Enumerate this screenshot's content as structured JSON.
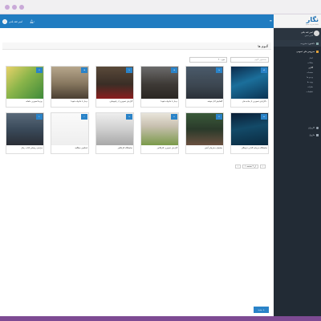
{
  "topbar": {
    "user_name": "امیر ثقه بلتی",
    "bell_count": "1"
  },
  "brand": {
    "logo": "نگار",
    "tagline": "سامانه مدیریت محتوا"
  },
  "sidebar": {
    "user_name": "امیر ثقه بلتی",
    "user_role": "کاربر ادمین",
    "items": [
      {
        "label": "داشبورد مدیریت"
      },
      {
        "label": "سرویس های عمومی"
      },
      {
        "label": "اخبار"
      },
      {
        "label": "مقالات"
      },
      {
        "label": "گالری"
      },
      {
        "label": "صفحات"
      },
      {
        "label": "ویدیو ها"
      },
      {
        "label": "پیوند ها"
      },
      {
        "label": "نظرات"
      },
      {
        "label": "تنظیمات"
      },
      {
        "label": "کاربران"
      },
      {
        "label": "ماژول"
      }
    ]
  },
  "page": {
    "title": "آلبوم ها",
    "search_placeholder": "جستجوی آلبوم",
    "select_value": "۲۰ مورد"
  },
  "albums": [
    {
      "caption": "گزارش تصویری از جاذبه های...",
      "badge": "۲۴"
    },
    {
      "caption": "گشایش آثار خوشه",
      "badge": "۱۲"
    },
    {
      "caption": "دیدار با خانواده شهدا",
      "badge": "۱۸"
    },
    {
      "caption": "گزارش تصویری از راهپیمایی",
      "badge": "۹"
    },
    {
      "caption": "دیدار با خانواده شهدا",
      "badge": "۱۵"
    },
    {
      "caption": "روزها تصویری ماهانه",
      "badge": "۷"
    },
    {
      "caption": "نمایشگاه سرمایه گذاری فرهنگی",
      "badge": "۲۲"
    },
    {
      "caption": "جشنواره هنرهای آئینی",
      "badge": "۱۱"
    },
    {
      "caption": "گزارش تصویری کاریکاتور",
      "badge": "۸"
    },
    {
      "caption": "نمایشگاه کاریکاتور",
      "badge": "۱۳"
    },
    {
      "caption": "اسکیس مطالعه",
      "badge": "۶"
    },
    {
      "caption": "مراسم رونمایی کتاب رجال",
      "badge": "۱۰"
    }
  ],
  "pager": {
    "label": "۱ از ۲ صفحه",
    "next": "›",
    "prev": "‹"
  },
  "actions": {
    "add_label": "جدید"
  },
  "colors": {
    "accent": "#2a83c8",
    "sidebar": "#222b35",
    "topbar": "#207cc1",
    "frame": "#7d4a93"
  }
}
